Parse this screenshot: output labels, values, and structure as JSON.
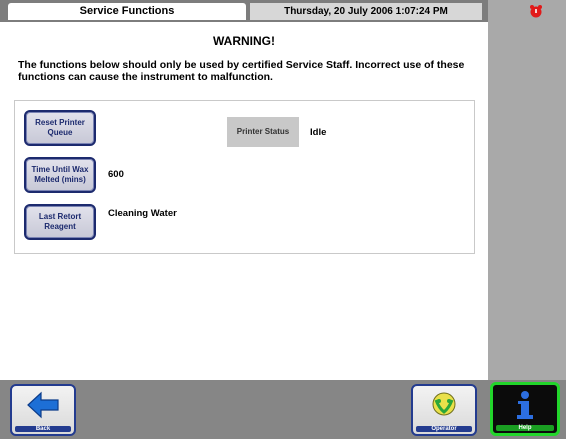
{
  "header": {
    "title": "Service Functions",
    "datetime": "Thursday, 20 July 2006 1:07:24 PM",
    "alarm_icon": "alarm-bell-icon"
  },
  "warning": {
    "title": "WARNING!",
    "text": "The functions below should only be used by certified Service Staff. Incorrect use of these functions can cause the instrument to malfunction."
  },
  "functions": {
    "reset_printer_queue": {
      "label": "Reset Printer Queue"
    },
    "time_until_wax": {
      "label": "Time Until Wax Melted (mins)",
      "value": "600"
    },
    "last_retort_reagent": {
      "label": "Last Retort Reagent",
      "value": "Cleaning Water"
    },
    "printer_status": {
      "label": "Printer Status",
      "value": "Idle"
    }
  },
  "nav": {
    "back": {
      "label": "Back",
      "icon": "arrow-left-icon"
    },
    "operator": {
      "label": "Operator",
      "icon": "operator-icon"
    },
    "help": {
      "label": "Help",
      "icon": "info-icon"
    }
  },
  "colors": {
    "button_border": "#1c2a6e",
    "help_border": "#22d62b",
    "header_bg": "#7d7d7d",
    "side_panel": "#a9a9a9"
  }
}
